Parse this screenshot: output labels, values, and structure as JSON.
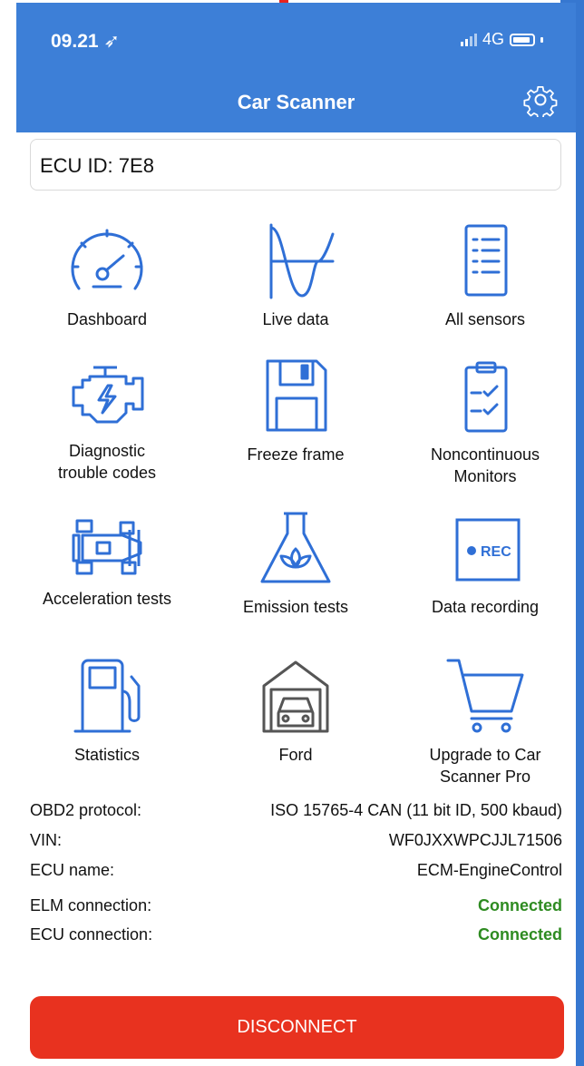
{
  "status_bar": {
    "time": "09.21",
    "network": "4G"
  },
  "header": {
    "title": "Car Scanner"
  },
  "ecu": {
    "label": "ECU ID: 7E8"
  },
  "menu": {
    "dashboard": "Dashboard",
    "live_data": "Live data",
    "all_sensors": "All sensors",
    "dtc_line1": "Diagnostic",
    "dtc_line2": "trouble codes",
    "freeze_frame": "Freeze frame",
    "noncontinuous_line1": "Noncontinuous",
    "noncontinuous_line2": "Monitors",
    "acceleration_tests": "Acceleration tests",
    "emission_tests": "Emission tests",
    "data_recording": "Data recording",
    "rec_badge": "REC",
    "statistics": "Statistics",
    "ford": "Ford",
    "upgrade_line1": "Upgrade to Car",
    "upgrade_line2": "Scanner Pro"
  },
  "info": {
    "obd2_label": "OBD2 protocol:",
    "obd2_value": "ISO 15765-4 CAN (11 bit ID, 500 kbaud)",
    "vin_label": "VIN:",
    "vin_value": "WF0JXXWPCJJL71506",
    "ecu_name_label": "ECU name:",
    "ecu_name_value": "ECM-EngineControl",
    "elm_label": "ELM connection:",
    "elm_value": "Connected",
    "ecu_conn_label": "ECU connection:",
    "ecu_conn_value": "Connected"
  },
  "actions": {
    "disconnect": "DISCONNECT"
  },
  "colors": {
    "header": "#3d7fd7",
    "icon": "#2f6fd6",
    "ok": "#2e8b21",
    "danger": "#e8321f"
  }
}
